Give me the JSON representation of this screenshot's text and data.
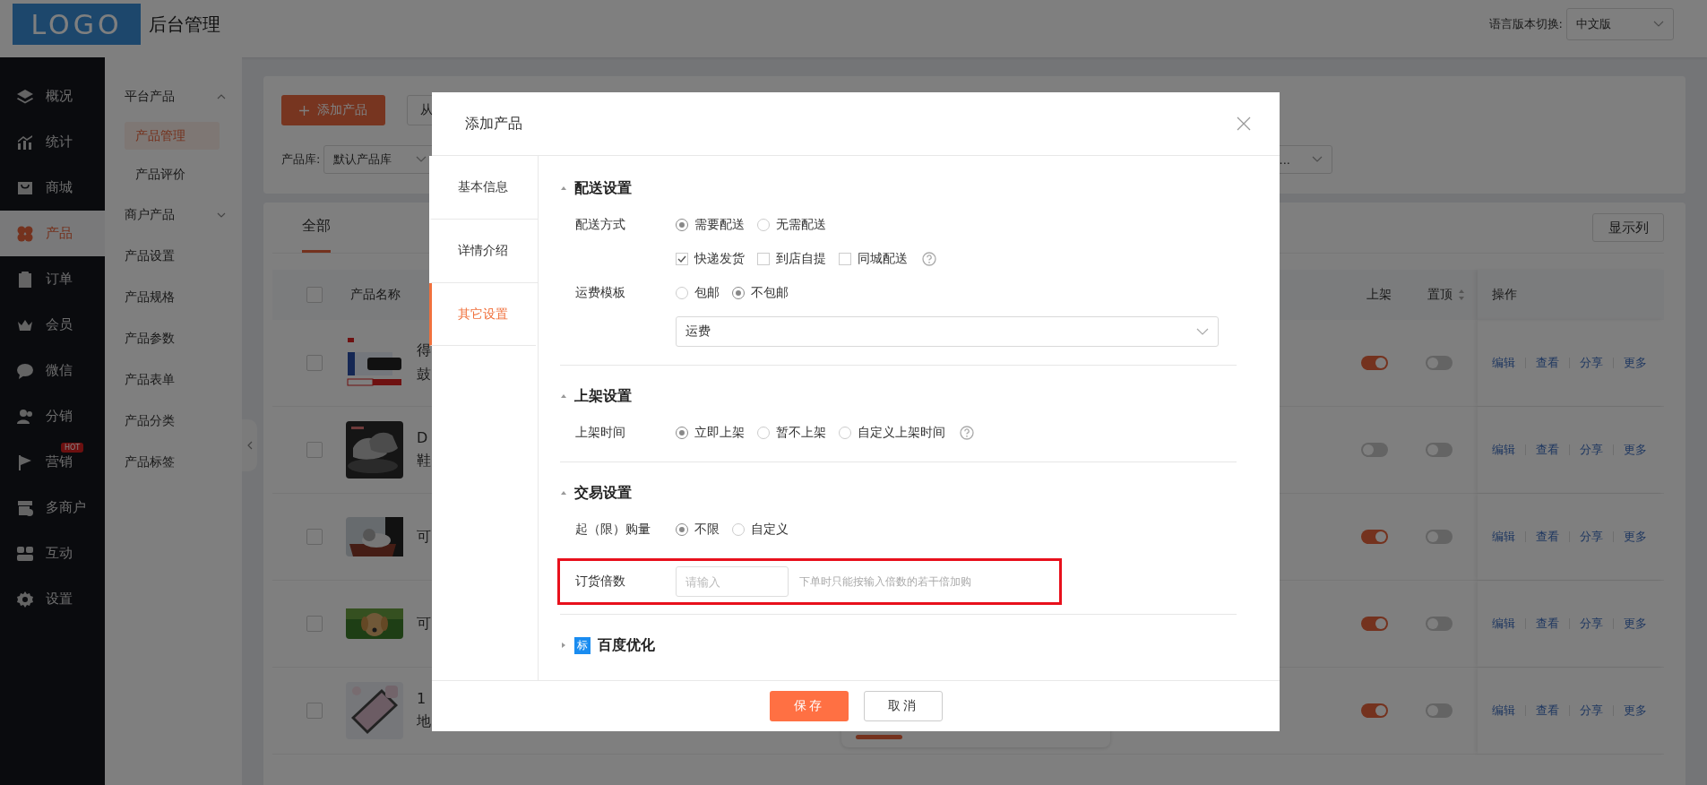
{
  "header": {
    "logo": "LOGO",
    "title": "后台管理",
    "language_label": "语言版本切换:",
    "language_select": "中文版"
  },
  "nav": [
    {
      "label": "概况",
      "selected": false
    },
    {
      "label": "统计",
      "selected": false
    },
    {
      "label": "商城",
      "selected": false
    },
    {
      "label": "产品",
      "selected": true
    },
    {
      "label": "订单",
      "selected": false
    },
    {
      "label": "会员",
      "selected": false
    },
    {
      "label": "微信",
      "selected": false
    },
    {
      "label": "分销",
      "selected": false
    },
    {
      "label": "营销",
      "selected": false,
      "badge": "HOT"
    },
    {
      "label": "多商户",
      "selected": false
    },
    {
      "label": "互动",
      "selected": false
    },
    {
      "label": "设置",
      "selected": false
    }
  ],
  "subnav": [
    {
      "kind": "group",
      "label": "平台产品",
      "expanded": true,
      "children": [
        {
          "label": "产品管理",
          "selected": true
        },
        {
          "label": "产品评价",
          "selected": false
        }
      ]
    },
    {
      "kind": "group",
      "label": "商户产品",
      "expanded": false
    },
    {
      "kind": "item",
      "label": "产品设置"
    },
    {
      "kind": "item",
      "label": "产品规格"
    },
    {
      "kind": "item",
      "label": "产品参数"
    },
    {
      "kind": "item",
      "label": "产品表单"
    },
    {
      "kind": "item",
      "label": "产品分类"
    },
    {
      "kind": "item",
      "label": "产品标签"
    }
  ],
  "toolbar": {
    "add_button": "添加产品",
    "import_button": "从",
    "library_label": "产品库:",
    "library_select": "默认产品库",
    "filter_select": "..."
  },
  "tabs": [
    {
      "label": "全部",
      "selected": true
    }
  ],
  "columns_button": "显示列",
  "table": {
    "select_all_checked": false,
    "columns": [
      "产品名称",
      "上架",
      "置顶",
      "操作"
    ],
    "rows": [
      {
        "checked": false,
        "name": [
          "得",
          "鼓"
        ],
        "listed": true,
        "pinned": false,
        "actions": [
          "编辑",
          "查看",
          "分享",
          "更多"
        ]
      },
      {
        "checked": false,
        "name": [
          "D",
          "鞋"
        ],
        "listed": false,
        "pinned": false,
        "actions": [
          "编辑",
          "查看",
          "分享",
          "更多"
        ]
      },
      {
        "checked": false,
        "name": [
          "可"
        ],
        "listed": true,
        "pinned": false,
        "actions": [
          "编辑",
          "查看",
          "分享",
          "更多"
        ]
      },
      {
        "checked": false,
        "name": [
          "可"
        ],
        "listed": true,
        "pinned": false,
        "actions": [
          "编辑",
          "查看",
          "分享",
          "更多"
        ]
      },
      {
        "checked": false,
        "name": [
          "1",
          "地"
        ],
        "listed": true,
        "pinned": false,
        "actions": [
          "编辑",
          "查看",
          "分享",
          "更多"
        ]
      }
    ]
  },
  "dialog": {
    "title": "添加产品",
    "tabs": [
      {
        "label": "基本信息",
        "selected": false
      },
      {
        "label": "详情介绍",
        "selected": false
      },
      {
        "label": "其它设置",
        "selected": true
      }
    ],
    "sections": [
      {
        "title": "配送设置",
        "expanded": true,
        "fields": [
          {
            "kind": "radio",
            "label": "配送方式",
            "options": [
              {
                "label": "需要配送",
                "selected": true
              },
              {
                "label": "无需配送",
                "selected": false
              }
            ]
          },
          {
            "kind": "checkbox",
            "options": [
              {
                "label": "快递发货",
                "checked": true
              },
              {
                "label": "到店自提",
                "checked": false
              },
              {
                "label": "同城配送",
                "checked": false
              }
            ],
            "help": true
          },
          {
            "kind": "radio",
            "label": "运费模板",
            "options": [
              {
                "label": "包邮",
                "selected": false
              },
              {
                "label": "不包邮",
                "selected": true
              }
            ]
          },
          {
            "kind": "select",
            "value": "运费"
          }
        ]
      },
      {
        "title": "上架设置",
        "expanded": true,
        "fields": [
          {
            "kind": "radio",
            "label": "上架时间",
            "options": [
              {
                "label": "立即上架",
                "selected": true
              },
              {
                "label": "暂不上架",
                "selected": false
              },
              {
                "label": "自定义上架时间",
                "selected": false
              }
            ],
            "help": true
          }
        ]
      },
      {
        "title": "交易设置",
        "expanded": true,
        "fields": [
          {
            "kind": "radio",
            "label": "起（限）购量",
            "options": [
              {
                "label": "不限",
                "selected": true
              },
              {
                "label": "自定义",
                "selected": false
              }
            ]
          },
          {
            "kind": "input",
            "label": "订货倍数",
            "placeholder": "请输入",
            "hint": "下单时只能按输入倍数的若干倍加购",
            "highlighted": true
          }
        ]
      },
      {
        "title": "百度优化",
        "expanded": false,
        "tag": "标"
      }
    ],
    "buttons": [
      {
        "label": "保存",
        "kind": "primary"
      },
      {
        "label": "取消",
        "kind": "default"
      }
    ]
  }
}
